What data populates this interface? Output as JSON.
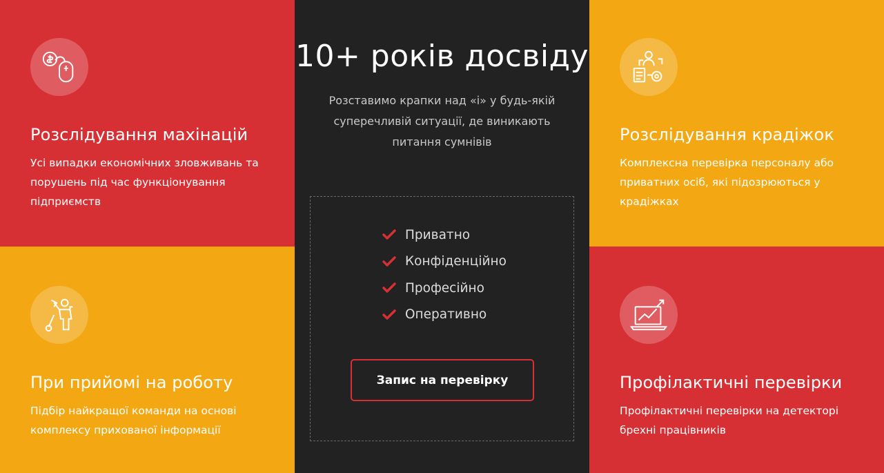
{
  "cards": {
    "top_left": {
      "icon": "money-mouse-icon",
      "title": "Розслідування махінацій",
      "text": "Усі випадки економічних зловживань та порушень під час функціонування підприємств"
    },
    "bottom_left": {
      "icon": "worker-tools-icon",
      "title": "При прийомі на роботу",
      "text": "Підбір найкращої команди на основі комплексу прихованої інформації"
    },
    "top_right": {
      "icon": "personnel-check-icon",
      "title": "Розслідування крадіжок",
      "text": "Комплексна перевірка персоналу або приватних осіб, які підозрюються у крадіжках"
    },
    "bottom_right": {
      "icon": "laptop-chart-icon",
      "title": "Профілактичні перевірки",
      "text": "Профілактичні перевірки на детекторі брехні працівників"
    }
  },
  "center": {
    "heading": "10+ років досвіду",
    "subtitle": "Розставимо крапки над «і» у будь-якій суперечливій ситуації, де виникають питання сумнівів",
    "checks": [
      "Приватно",
      "Конфіденційно",
      "Професійно",
      "Оперативно"
    ],
    "cta_label": "Запис на перевірку"
  },
  "colors": {
    "red": "#d73034",
    "yellow": "#f3a713",
    "dark": "#222222"
  }
}
